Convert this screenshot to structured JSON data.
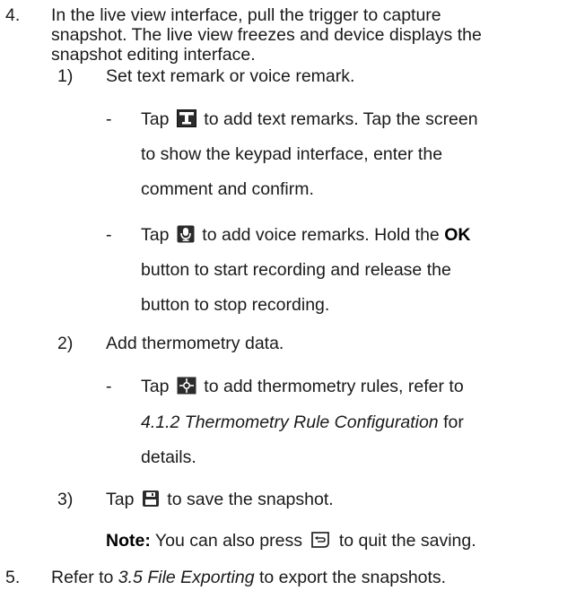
{
  "step4": {
    "num": "4.",
    "lines": [
      "In the live view interface, pull the trigger to capture",
      "snapshot. The live view freezes and device displays the",
      "snapshot editing interface."
    ]
  },
  "sub1": {
    "num": "1)",
    "text": "Set text remark or voice remark.",
    "bulletA": {
      "dash": "-",
      "tap": "Tap",
      "icon": "text-icon",
      "rest": "to add text remarks. Tap the screen",
      "line2": "to show the keypad interface, enter the",
      "line3": "comment and confirm."
    },
    "bulletB": {
      "dash": "-",
      "tap": "Tap",
      "icon": "microphone-icon",
      "rest": "to add voice remarks. Hold the",
      "ok": "OK",
      "line2": "button to start recording and release the",
      "line3": "button to stop recording."
    }
  },
  "sub2": {
    "num": "2)",
    "text": "Add thermometry data.",
    "bulletA": {
      "dash": "-",
      "tap": "Tap",
      "icon": "thermometry-rule-icon",
      "rest": "to add thermometry rules, refer to",
      "ref": "4.1.2 Thermometry Rule Configuration",
      "ref_tail": "for",
      "line3": "details."
    }
  },
  "sub3": {
    "num": "3)",
    "tap": "Tap",
    "icon": "save-icon",
    "rest": "to save the snapshot."
  },
  "note": {
    "label": "Note:",
    "text": "You can also press",
    "icon": "back-icon",
    "tail": "to quit the saving."
  },
  "step5": {
    "num": "5.",
    "pre": "Refer to",
    "ref": "3.5 File Exporting",
    "post": "to export the snapshots."
  }
}
